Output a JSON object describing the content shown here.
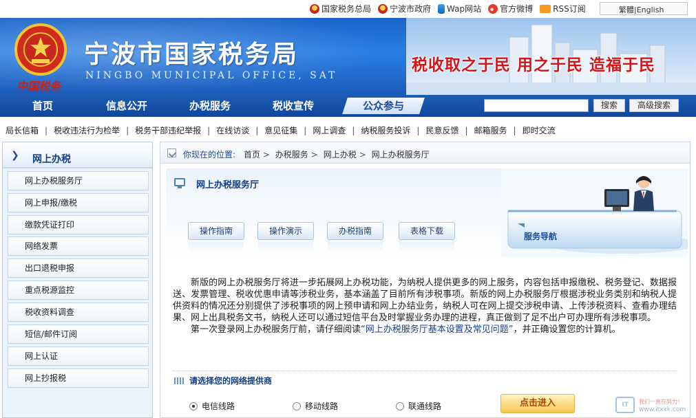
{
  "toplinks": [
    {
      "label": "国家税务总局",
      "icon": "emblem-icon"
    },
    {
      "label": "宁波市政府",
      "icon": "emblem-icon"
    },
    {
      "label": "Wap网站",
      "icon": "wap-icon"
    },
    {
      "label": "官方微博",
      "icon": "weibo-icon"
    },
    {
      "label": "RSS订阅",
      "icon": "rss-icon"
    }
  ],
  "lang": "繁體|English",
  "header": {
    "logo_text": "中国税务",
    "title": "宁波市国家税务局",
    "subtitle": "NINGBO MUNICIPAL OFFICE, SAT",
    "slogan": "税收取之于民  用之于民  造福于民"
  },
  "nav": {
    "items": [
      "首页",
      "信息公开",
      "办税服务",
      "税收宣传",
      "公众参与"
    ],
    "active_index": 4,
    "search_button": "搜索",
    "advanced_search_button": "高级搜索"
  },
  "sublinks": [
    "局长信箱",
    "税收违法行为检举",
    "税务干部违纪举报",
    "在线访谈",
    "意见征集",
    "网上调查",
    "纳税服务投诉",
    "民意反馈",
    "邮箱服务",
    "即时交流"
  ],
  "sidebar": {
    "title": "网上办税",
    "items": [
      "网上办税服务厅",
      "网上申报/缴税",
      "缴款凭证打印",
      "网络发票",
      "出口退税申报",
      "重点税源监控",
      "税收资料调查",
      "短信/邮件订阅",
      "网上认证",
      "网上抄报税"
    ]
  },
  "breadcrumb": {
    "label": "你现在的位置:",
    "items": [
      "首页",
      "办税服务",
      "网上办税",
      "网上办税服务厅"
    ]
  },
  "hall": {
    "title": "网上办税服务厅",
    "buttons": [
      "操作指南",
      "操作演示",
      "办税指南",
      "表格下载"
    ],
    "guide_label": "服务导航"
  },
  "intro": {
    "p1": "新版的网上办税服务厅将进一步拓展网上办税功能，为纳税人提供更多的网上服务，内容包括申报缴税、税务登记、数据报送、发票管理、税收优惠申请等涉税业务，基本涵盖了目前所有涉税事项。新版的网上办税服务厅根据涉税业务类别和纳税人提供资料的情况还分别提供了涉税事项的网上预申请和网上办结业务，纳税人可在网上提交涉税申请、上传涉税资料、查看办理结果、网上出具税务文书，纳税人还可以通过短信平台及时掌握业务办理的进程，真正做到了足不出户可办理所有涉税事项。",
    "p2_before": "第一次登录网上办税服务厅前，请仔细阅读",
    "p2_link": "“网上办税服务厅基本设置及常见问题”",
    "p2_after": "，并正确设置您的计算机。"
  },
  "isp": {
    "label": "请选择您的网络提供商",
    "options": [
      "电信线路",
      "移动线路",
      "联通线路"
    ],
    "selected_index": 0,
    "enter_button": "点击进入"
  },
  "watermark": {
    "logo": "IT",
    "line1": "我们一直在努力！",
    "line2": "www.itxxk.com"
  },
  "colors": {
    "brand_blue": "#1a63c8",
    "nav_blue": "#0f479c",
    "slogan_red": "#d4161b",
    "enter_orange": "#f7c74e"
  }
}
